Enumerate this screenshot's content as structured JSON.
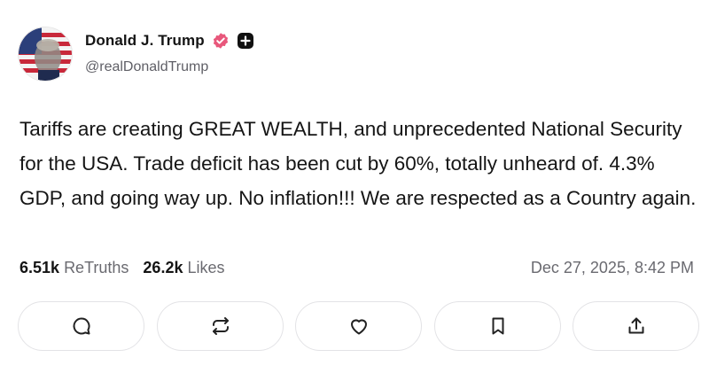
{
  "author": {
    "name": "Donald J. Trump",
    "handle": "@realDonaldTrump",
    "badges": [
      "verified-icon",
      "plus-icon"
    ]
  },
  "post": {
    "text": "Tariffs are creating GREAT WEALTH, and unprecedented National Security for the USA. Trade deficit has been cut by 60%, totally unheard of. 4.3% GDP, and going way up. No inflation!!! We are respected as a Country again."
  },
  "stats": {
    "retruths_count": "6.51k",
    "retruths_label": "ReTruths",
    "likes_count": "26.2k",
    "likes_label": "Likes",
    "timestamp": "Dec 27, 2025, 8:42 PM"
  },
  "actions": [
    "reply-icon",
    "retruth-icon",
    "like-icon",
    "bookmark-icon",
    "share-icon"
  ],
  "colors": {
    "verified_badge": "#e8577b",
    "text": "#151515",
    "muted": "#6a6a70",
    "border": "#e3e3e6"
  }
}
